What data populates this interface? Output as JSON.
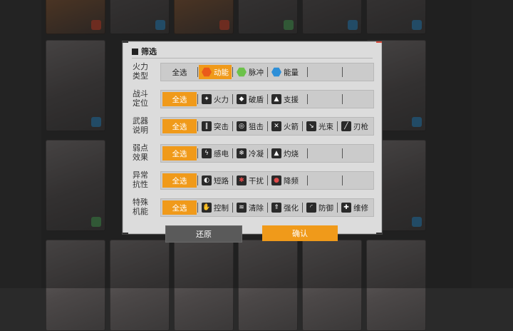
{
  "dialog": {
    "title": "筛选",
    "rows": [
      {
        "label_line1": "火力",
        "label_line2": "类型",
        "all": "全选",
        "all_selected": false,
        "options": [
          {
            "label": "动能",
            "icon": "kinetic-hex-icon",
            "selected": true
          },
          {
            "label": "脉冲",
            "icon": "pulse-hex-icon",
            "selected": false
          },
          {
            "label": "能量",
            "icon": "energy-hex-icon",
            "selected": false
          }
        ]
      },
      {
        "label_line1": "战斗",
        "label_line2": "定位",
        "all": "全选",
        "all_selected": true,
        "options": [
          {
            "label": "火力",
            "icon": "firepower-icon",
            "selected": false
          },
          {
            "label": "破盾",
            "icon": "shield-break-icon",
            "selected": false
          },
          {
            "label": "支援",
            "icon": "support-icon",
            "selected": false
          }
        ]
      },
      {
        "label_line1": "武器",
        "label_line2": "说明",
        "all": "全选",
        "all_selected": true,
        "options": [
          {
            "label": "突击",
            "icon": "assault-icon",
            "selected": false
          },
          {
            "label": "狙击",
            "icon": "sniper-icon",
            "selected": false
          },
          {
            "label": "火箭",
            "icon": "rocket-icon",
            "selected": false
          },
          {
            "label": "光束",
            "icon": "beam-icon",
            "selected": false
          },
          {
            "label": "刃枪",
            "icon": "blade-gun-icon",
            "selected": false
          }
        ]
      },
      {
        "label_line1": "弱点",
        "label_line2": "效果",
        "all": "全选",
        "all_selected": true,
        "options": [
          {
            "label": "感电",
            "icon": "shock-icon",
            "selected": false
          },
          {
            "label": "冷凝",
            "icon": "freeze-icon",
            "selected": false
          },
          {
            "label": "灼烧",
            "icon": "burn-icon",
            "selected": false
          }
        ]
      },
      {
        "label_line1": "异常",
        "label_line2": "抗性",
        "all": "全选",
        "all_selected": true,
        "options": [
          {
            "label": "短路",
            "icon": "short-circuit-icon",
            "selected": false
          },
          {
            "label": "干扰",
            "icon": "interference-icon",
            "selected": false
          },
          {
            "label": "降频",
            "icon": "downclock-icon",
            "selected": false
          }
        ]
      },
      {
        "label_line1": "特殊",
        "label_line2": "机能",
        "all": "全选",
        "all_selected": true,
        "options": [
          {
            "label": "控制",
            "icon": "control-icon",
            "selected": false
          },
          {
            "label": "清除",
            "icon": "cleanse-icon",
            "selected": false
          },
          {
            "label": "强化",
            "icon": "enhance-icon",
            "selected": false
          },
          {
            "label": "防御",
            "icon": "defense-icon",
            "selected": false
          },
          {
            "label": "维修",
            "icon": "repair-icon",
            "selected": false
          }
        ]
      }
    ],
    "reset_label": "还原",
    "confirm_label": "确认"
  },
  "colors": {
    "accent": "#f09a1a",
    "dialog_bg": "#dcdcdc",
    "reset_button": "#5a5a5a"
  }
}
